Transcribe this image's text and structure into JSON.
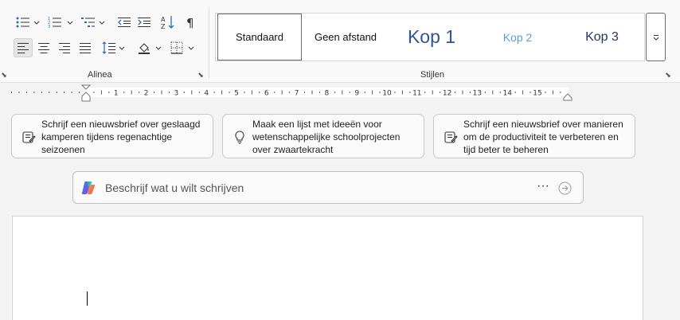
{
  "ribbon": {
    "alinea": {
      "label": "Alinea",
      "buttons": [
        {
          "name": "bullets-icon"
        },
        {
          "name": "numbering-icon"
        },
        {
          "name": "multilevel-list-icon"
        },
        {
          "name": "decrease-indent-icon"
        },
        {
          "name": "increase-indent-icon"
        },
        {
          "name": "sort-icon"
        },
        {
          "name": "show-formatting-marks-icon"
        },
        {
          "name": "align-left-icon",
          "active": true
        },
        {
          "name": "align-center-icon"
        },
        {
          "name": "align-right-icon"
        },
        {
          "name": "justify-icon"
        },
        {
          "name": "line-spacing-icon"
        },
        {
          "name": "shading-icon"
        },
        {
          "name": "borders-icon"
        }
      ]
    },
    "stijlen": {
      "label": "Stijlen",
      "items": [
        {
          "label": "Standaard",
          "selected": true
        },
        {
          "label": "Geen afstand"
        },
        {
          "label": "Kop 1"
        },
        {
          "label": "Kop 2"
        },
        {
          "label": "Kop 3"
        }
      ]
    }
  },
  "ruler": {
    "numbers": [
      "1",
      "2",
      "3",
      "4",
      "5",
      "6",
      "7",
      "8",
      "9",
      "10",
      "11",
      "12",
      "13",
      "14",
      "15"
    ]
  },
  "suggestions": [
    {
      "text": "Schrijf een nieuwsbrief over geslaagd kamperen tijdens regenachtige seizoenen",
      "icon": "document-edit-icon"
    },
    {
      "text": "Maak een lijst met ideeën voor wetenschappelijke schoolprojecten over zwaartekracht",
      "icon": "lightbulb-icon"
    },
    {
      "text": "Schrijf een nieuwsbrief over manieren om de productiviteit te verbeteren en tijd beter te beheren",
      "icon": "document-edit-icon"
    }
  ],
  "prompt": {
    "placeholder": "Beschrijf wat u wilt schrijven",
    "more_label": "···"
  },
  "colors": {
    "kop1": "#2f5496",
    "kop2": "#5b9bd5",
    "kop3": "#1f3763"
  }
}
